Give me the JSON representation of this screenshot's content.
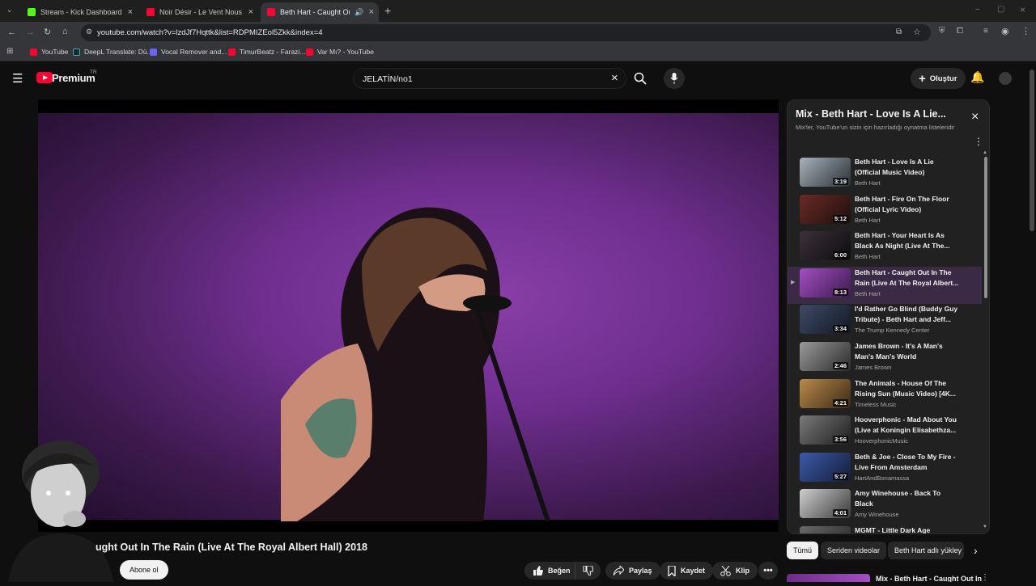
{
  "browser": {
    "tabs": [
      {
        "title": "Stream - Kick Dashboard",
        "favicon_color": "#53fc18",
        "icon": "kick-icon"
      },
      {
        "title": "Noir Désir - Le Vent Nous Porte",
        "favicon_color": "#ff0033",
        "icon": "youtube-icon"
      },
      {
        "title": "Beth Hart - Caught Out In T",
        "favicon_color": "#ff0033",
        "icon": "youtube-icon"
      }
    ],
    "url": "youtube.com/watch?v=lzdJf7Hqttk&list=RDPMIZEol5Zkk&index=4",
    "bookmarks": [
      {
        "label": "YouTube",
        "color": "#ff0033"
      },
      {
        "label": "DeepL Translate: Dü...",
        "color": "#0f2b46"
      },
      {
        "label": "Vocal Remover and...",
        "color": "#6c63ff"
      },
      {
        "label": "TimurBeatz - Farazi...",
        "color": "#ff0033"
      },
      {
        "label": "Var Mı? - YouTube",
        "color": "#ff0033"
      }
    ]
  },
  "header": {
    "logo_text": "Premium",
    "region": "TR",
    "search_value": "JELATİN/no1",
    "create_label": "Oluştur"
  },
  "video": {
    "title": "ught Out In The Rain (Live At The Royal Albert Hall) 2018",
    "subscribe_label": "Abone ol",
    "actions": {
      "like": "Beğen",
      "share": "Paylaş",
      "save": "Kaydet",
      "clip": "Klip"
    }
  },
  "playlist": {
    "title": "Mix - Beth Hart - Love Is A Lie...",
    "subtitle": "Mix'ler, YouTube'un sizin için hazırladığı oynatma listeleridir",
    "items": [
      {
        "title": "Beth Hart - Love Is A Lie (Official Music Video)",
        "channel": "Beth Hart",
        "duration": "3:19",
        "c1": "#a9b3bb",
        "c2": "#2a2f35"
      },
      {
        "title": "Beth Hart - Fire On The Floor (Official Lyric Video)",
        "channel": "Beth Hart",
        "duration": "5:12",
        "c1": "#6b2a25",
        "c2": "#1c0f0e"
      },
      {
        "title": "Beth Hart - Your Heart Is As Black As Night (Live At The...",
        "channel": "Beth Hart",
        "duration": "6:00",
        "c1": "#3a3238",
        "c2": "#0e0c10"
      },
      {
        "title": "Beth Hart - Caught Out In The Rain (Live At The Royal Albert...",
        "channel": "Beth Hart",
        "duration": "8:13",
        "c1": "#a24fc2",
        "c2": "#3d1a4d"
      },
      {
        "title": "I'd Rather Go Blind (Buddy Guy Tribute) - Beth Hart and Jeff...",
        "channel": "The Trump Kennedy Center",
        "duration": "3:34",
        "c1": "#3d4a66",
        "c2": "#141824"
      },
      {
        "title": "James Brown - It's A Man's Man's Man's World",
        "channel": "James Brown",
        "duration": "2:46",
        "c1": "#9a9a9a",
        "c2": "#2b2b2b"
      },
      {
        "title": "The Animals - House Of The Rising Sun (Music Video) [4K...",
        "channel": "Timeless Music",
        "duration": "4:21",
        "c1": "#b98a4c",
        "c2": "#3b2a16"
      },
      {
        "title": "Hooverphonic - Mad About You (Live at Koningin Elisabethza...",
        "channel": "HooverphonicMusic",
        "duration": "3:56",
        "c1": "#7a7a7a",
        "c2": "#1e1e1e"
      },
      {
        "title": "Beth & Joe - Close To My Fire - Live From Amsterdam",
        "channel": "HartAndBonamassa",
        "duration": "5:27",
        "c1": "#3c5aa8",
        "c2": "#141d38"
      },
      {
        "title": "Amy Winehouse - Back To Black",
        "channel": "Amy Winehouse",
        "duration": "4:01",
        "c1": "#cfcfcf",
        "c2": "#3a3a3a"
      },
      {
        "title": "MGMT - Little Dark Age",
        "channel": "",
        "duration": "",
        "c1": "#6a6a6a",
        "c2": "#222"
      }
    ]
  },
  "chips": [
    "Tümü",
    "Seriden videolar",
    "Beth Hart adlı yükley"
  ],
  "next_preview": "Mix - Beth Hart - Caught Out In"
}
